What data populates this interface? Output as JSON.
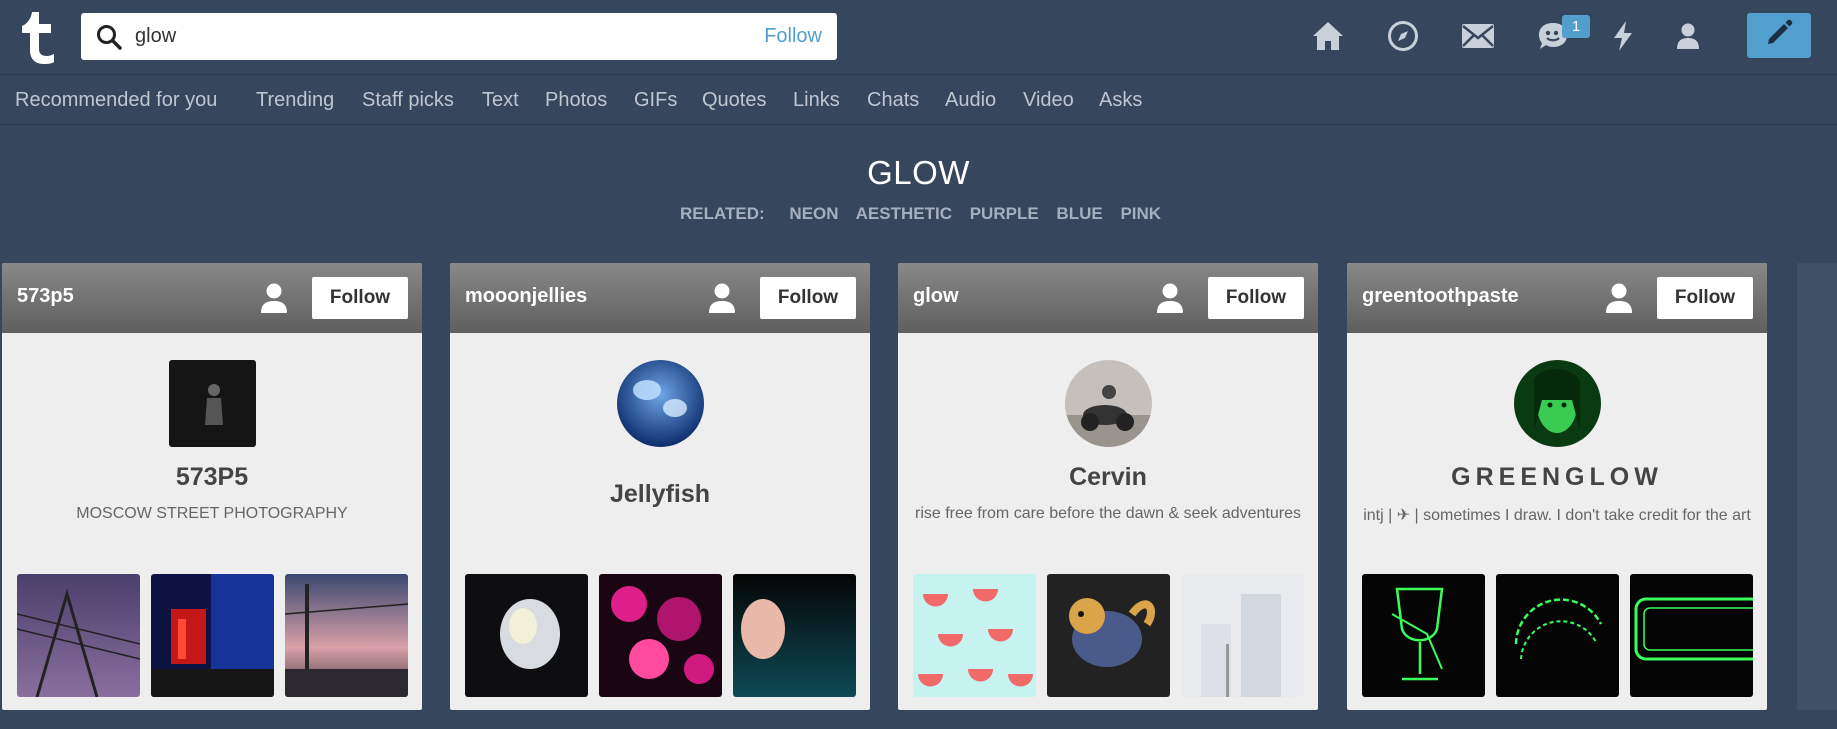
{
  "search": {
    "query": "glow",
    "follow_label": "Follow"
  },
  "header": {
    "icons": [
      "home-icon",
      "explore-icon",
      "inbox-icon",
      "messaging-icon",
      "activity-icon",
      "account-icon",
      "compose-icon"
    ],
    "messages_badge": "1"
  },
  "tabs": [
    {
      "label": "Recommended for you"
    },
    {
      "label": "Trending"
    },
    {
      "label": "Staff picks"
    },
    {
      "label": "Text"
    },
    {
      "label": "Photos"
    },
    {
      "label": "GIFs"
    },
    {
      "label": "Quotes"
    },
    {
      "label": "Links"
    },
    {
      "label": "Chats"
    },
    {
      "label": "Audio"
    },
    {
      "label": "Video"
    },
    {
      "label": "Asks"
    }
  ],
  "page": {
    "title": "GLOW",
    "related_label": "RELATED:",
    "related": [
      "NEON",
      "AESTHETIC",
      "PURPLE",
      "BLUE",
      "PINK"
    ]
  },
  "cards": [
    {
      "blog": "573p5",
      "follow": "Follow",
      "title": "573P5",
      "description": "MOSCOW STREET PHOTOGRAPHY"
    },
    {
      "blog": "mooonjellies",
      "follow": "Follow",
      "title": "Jellyfish",
      "description": ""
    },
    {
      "blog": "glow",
      "follow": "Follow",
      "title": "Cervin",
      "description": "rise free from care before the dawn & seek adventures"
    },
    {
      "blog": "greentoothpaste",
      "follow": "Follow",
      "title": "GREENGLOW",
      "description": "intj | ✈ | sometimes I draw. I don't take credit for the art"
    }
  ],
  "colors": {
    "background": "#36465d",
    "accent": "#529ecc",
    "card": "#eeeeee"
  }
}
